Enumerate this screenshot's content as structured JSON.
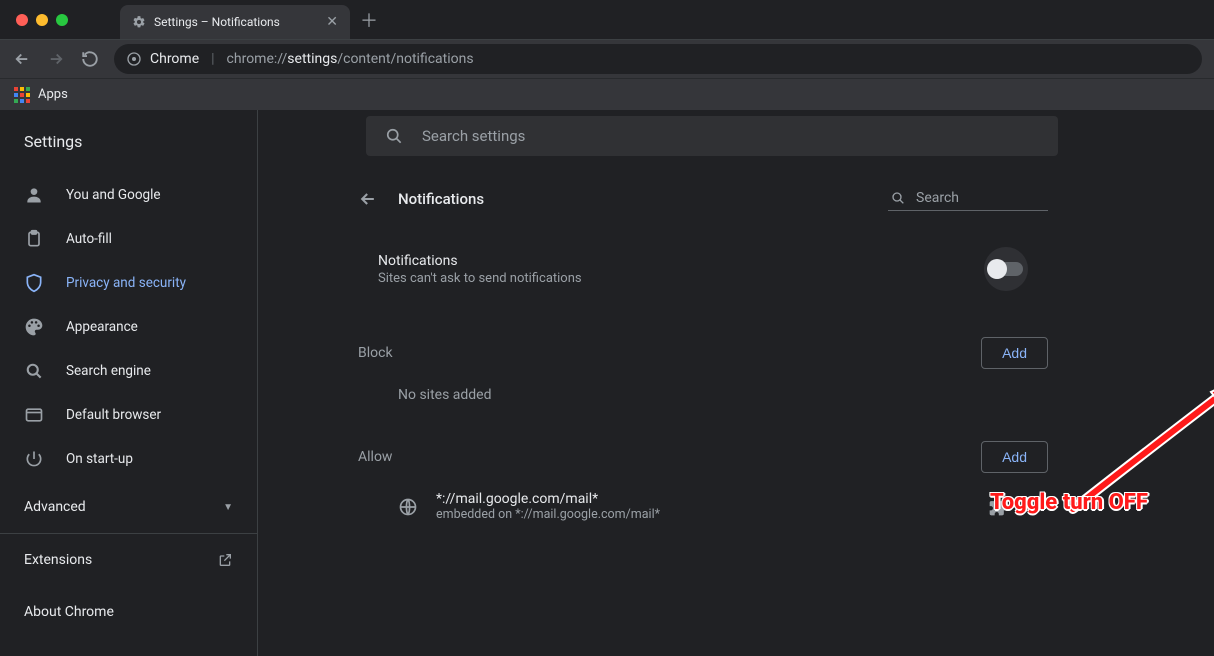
{
  "tab": {
    "title": "Settings – Notifications"
  },
  "omnibox": {
    "prefix": "Chrome",
    "url_dim1": "chrome://",
    "url_bold": "settings",
    "url_dim2": "/content/notifications"
  },
  "bookmarks": {
    "apps": "Apps"
  },
  "sidebar": {
    "heading": "Settings",
    "items": [
      {
        "label": "You and Google"
      },
      {
        "label": "Auto-fill"
      },
      {
        "label": "Privacy and security"
      },
      {
        "label": "Appearance"
      },
      {
        "label": "Search engine"
      },
      {
        "label": "Default browser"
      },
      {
        "label": "On start-up"
      }
    ],
    "advanced": "Advanced",
    "extensions": "Extensions",
    "about": "About Chrome"
  },
  "search_settings_placeholder": "Search settings",
  "page": {
    "title": "Notifications",
    "inline_search_placeholder": "Search",
    "notif_title": "Notifications",
    "notif_sub": "Sites can't ask to send notifications",
    "block": {
      "title": "Block",
      "add": "Add",
      "empty": "No sites added"
    },
    "allow": {
      "title": "Allow",
      "add": "Add",
      "items": [
        {
          "pattern": "*://mail.google.com/mail*",
          "embedded": "embedded on *://mail.google.com/mail*"
        }
      ]
    }
  },
  "annotation": {
    "label": "Toggle turn OFF"
  }
}
